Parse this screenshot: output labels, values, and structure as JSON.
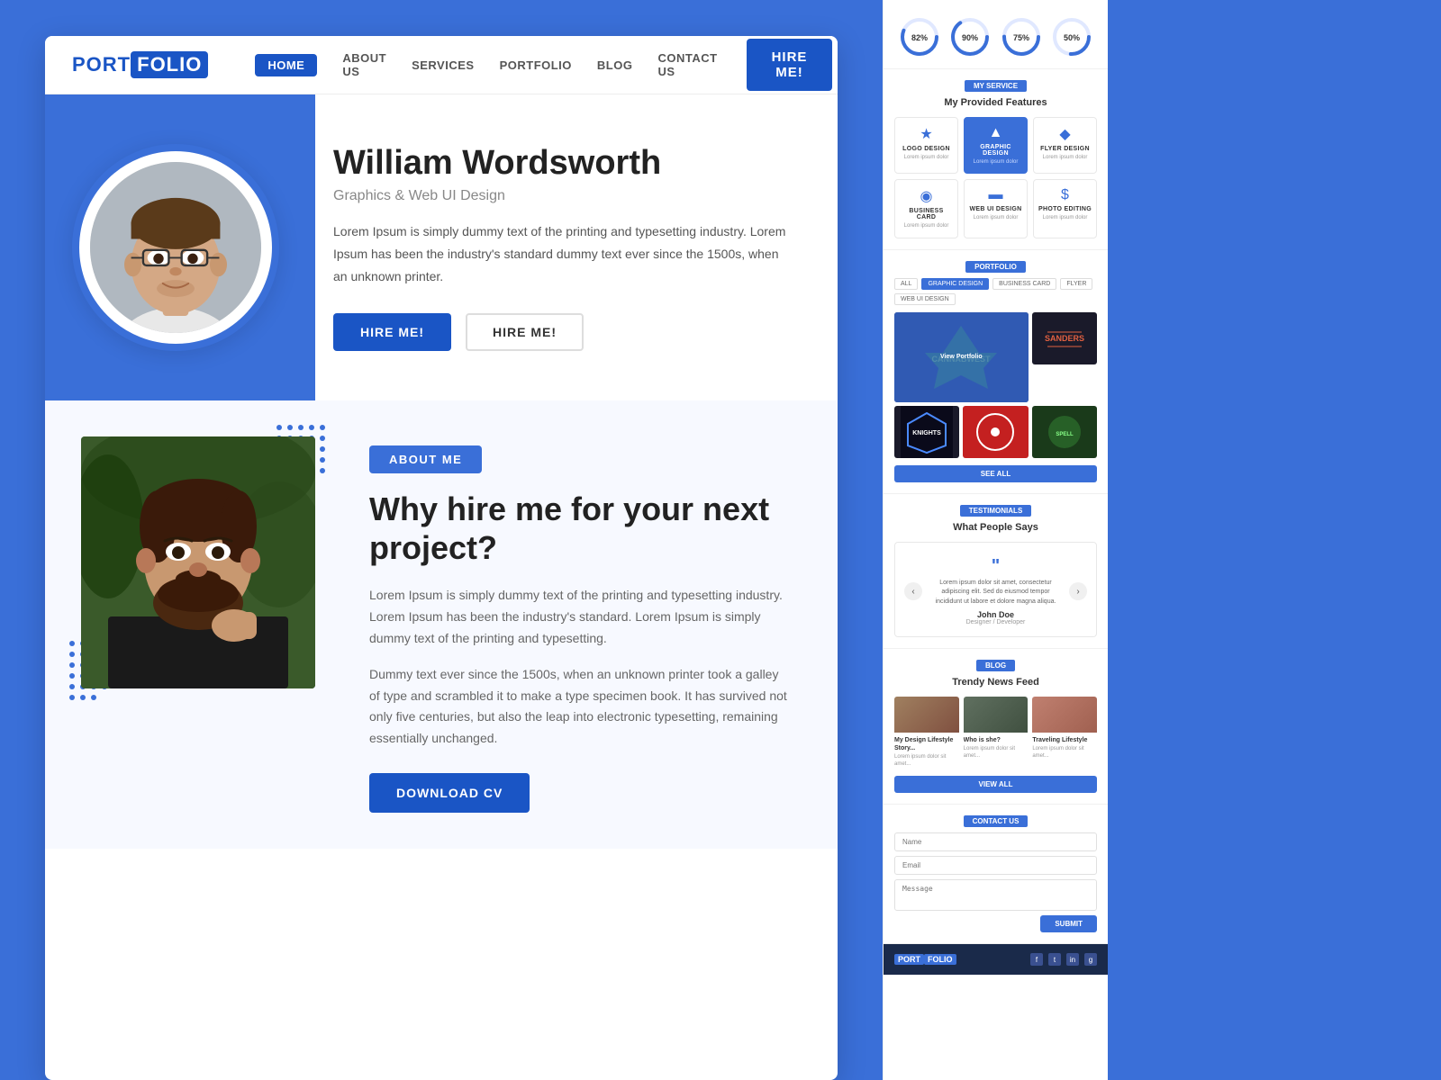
{
  "site": {
    "logo_port": "PORT",
    "logo_folio": "FOLIO"
  },
  "nav": {
    "links": [
      {
        "label": "HOME",
        "active": true
      },
      {
        "label": "ABOUT US",
        "active": false
      },
      {
        "label": "SERVICES",
        "active": false
      },
      {
        "label": "PORTFOLIO",
        "active": false
      },
      {
        "label": "BLOG",
        "active": false
      },
      {
        "label": "CONTACT US",
        "active": false
      }
    ],
    "hire_btn": "HIRE ME!"
  },
  "hero": {
    "name": "William Wordsworth",
    "subtitle": "Graphics & Web UI Design",
    "description": "Lorem Ipsum is simply dummy text of the printing and typesetting industry. Lorem Ipsum has been the industry's standard dummy text ever since the 1500s, when an unknown printer.",
    "btn1": "HIRE ME!",
    "btn2": "HIRE ME!"
  },
  "about": {
    "badge": "ABOUT ME",
    "title": "Why hire me for your next project?",
    "para1": "Lorem Ipsum is simply dummy text of the printing and typesetting industry. Lorem Ipsum has been the industry's standard. Lorem Ipsum is simply dummy text of the printing and typesetting.",
    "para2": "Dummy text ever since the 1500s, when an unknown printer took a galley of type and scrambled it to make a type specimen book. It has survived not only five centuries, but also the leap into electronic typesetting, remaining essentially unchanged.",
    "download_btn": "DOWNLOAD CV"
  },
  "skills": [
    {
      "label": "82%",
      "value": 82,
      "color": "#3a6fd8"
    },
    {
      "label": "90%",
      "value": 90,
      "color": "#3a6fd8"
    },
    {
      "label": "75%",
      "value": 75,
      "color": "#3a6fd8"
    },
    {
      "label": "50%",
      "value": 50,
      "color": "#3a6fd8"
    }
  ],
  "services_section": {
    "tag": "MY SERVICE",
    "title": "My Provided Features",
    "items": [
      {
        "name": "LOGO DESIGN",
        "icon": "★",
        "featured": false
      },
      {
        "name": "GRAPHIC DESIGN",
        "icon": "▲",
        "featured": true
      },
      {
        "name": "FLYER DESIGN",
        "icon": "◆",
        "featured": false
      },
      {
        "name": "BUSINESS CARD",
        "icon": "◉",
        "featured": false
      },
      {
        "name": "WEB UI DESIGN",
        "icon": "▬",
        "featured": false
      },
      {
        "name": "PHOTO EDITING",
        "icon": "$",
        "featured": false
      }
    ]
  },
  "portfolio_section": {
    "tag": "PORTFOLIO",
    "filters": [
      "ALL",
      "GRAPHIC DESIGN",
      "BUSINESS CARD",
      "FLYER",
      "WEB UI DESIGN"
    ],
    "active_filter": "GRAPHIC DESIGN",
    "see_all": "SEE ALL",
    "view_portfolio": "View Portfolio"
  },
  "testimonials": {
    "tag": "TESTIMONIALS",
    "title": "What People Says",
    "quote": "Lorem ipsum dolor sit amet, consectetur adipiscing elit. Sed do eiusmod tempor incididunt ut labore et dolore magna aliqua.",
    "name": "John Doe",
    "role": "Designer / Developer"
  },
  "blog": {
    "tag": "BLOG",
    "title": "Trendy News Feed",
    "posts": [
      {
        "title": "My Design Lifestyle Story...",
        "excerpt": "Lorem ipsum dolor sit amet..."
      },
      {
        "title": "Who is she?",
        "excerpt": "Lorem ipsum dolor sit amet..."
      },
      {
        "title": "Traveling Lifestyle",
        "excerpt": "Lorem ipsum dolor sit amet..."
      }
    ],
    "view_all": "VIEW ALL"
  },
  "contact": {
    "tag": "CONTACT US",
    "placeholder_name": "Name",
    "placeholder_email": "Email",
    "placeholder_message": "Message",
    "submit_btn": "SUBMIT"
  },
  "footer": {
    "logo_port": "PORT",
    "logo_folio": "FOLIO",
    "socials": [
      "f",
      "t",
      "in",
      "g+"
    ]
  }
}
